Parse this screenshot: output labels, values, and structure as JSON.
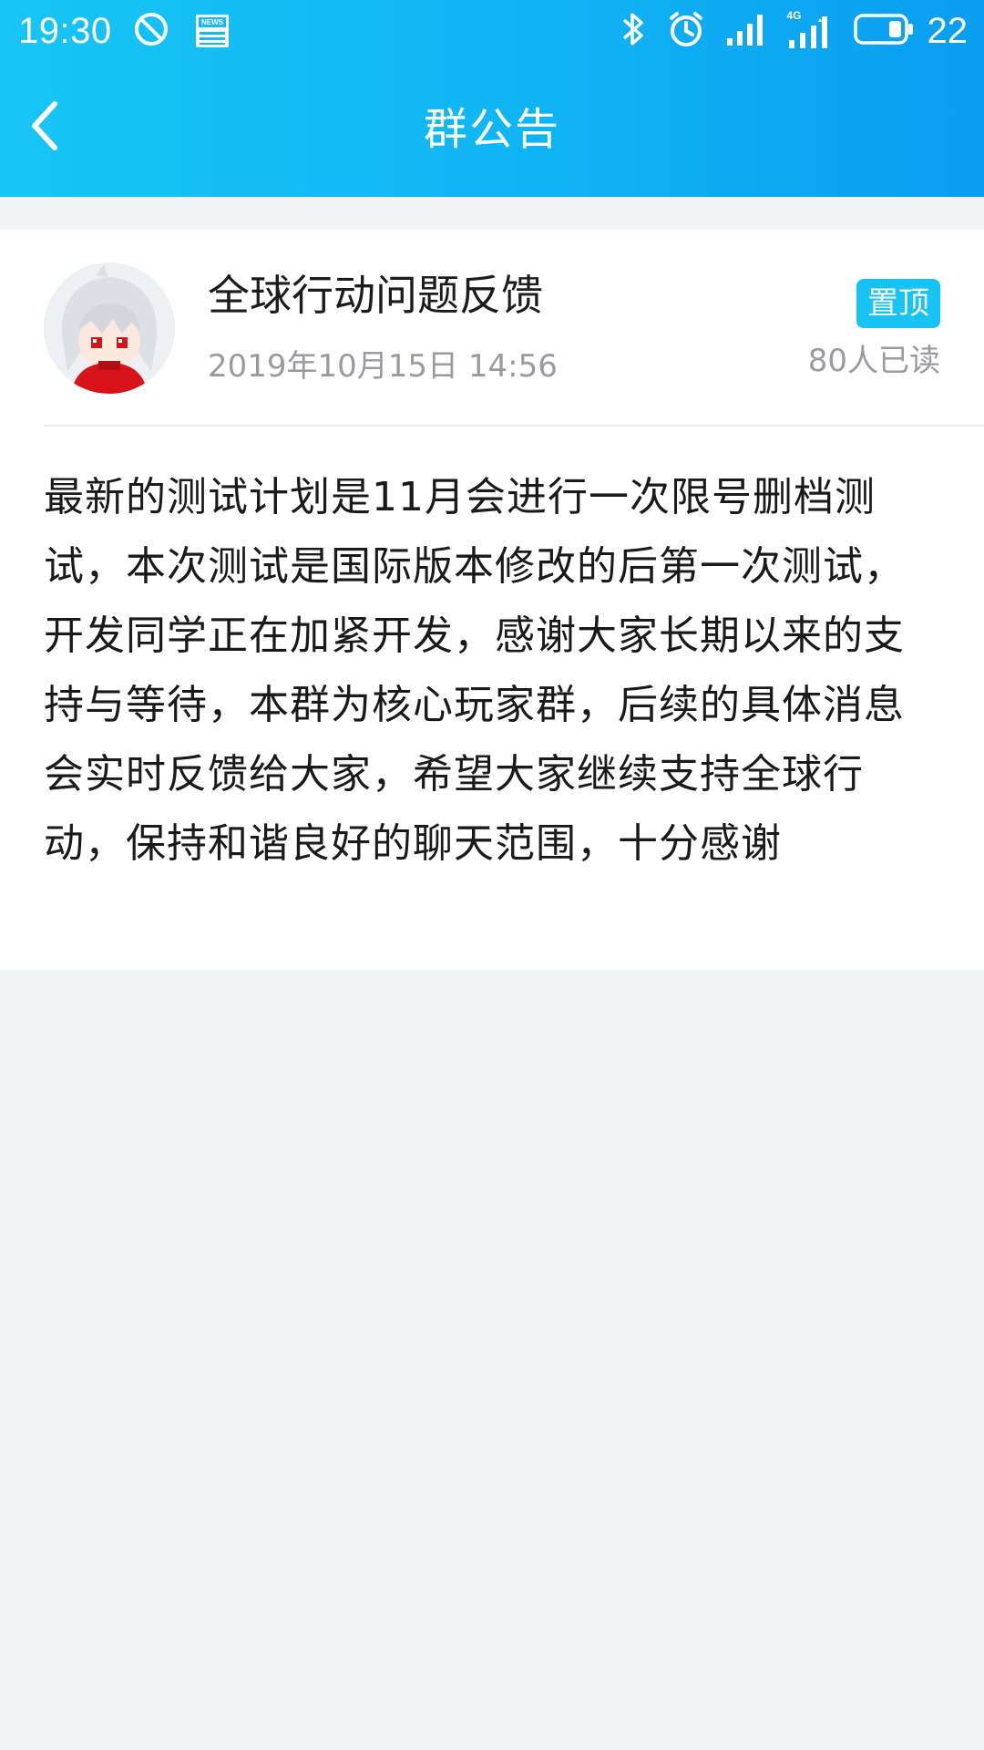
{
  "status_bar": {
    "time": "19:30",
    "left_icons": [
      "do-not-disturb-icon",
      "news-icon"
    ],
    "right_icons": [
      "bluetooth-icon",
      "alarm-icon",
      "signal-icon",
      "signal-4g-icon",
      "battery-icon"
    ],
    "battery_level": "22",
    "network_label": "4G",
    "news_label": "NEWS"
  },
  "title_bar": {
    "title": "群公告"
  },
  "announcement": {
    "author": "全球行动问题反馈",
    "timestamp": "2019年10月15日 14:56",
    "pin_label": "置顶",
    "read_count": "80人已读",
    "body": "最新的测试计划是11月会进行一次限号删档测试，本次测试是国际版本修改的后第一次测试，开发同学正在加紧开发，感谢大家长期以来的支持与等待，本群为核心玩家群，后续的具体消息会实时反馈给大家，希望大家继续支持全球行动，保持和谐良好的聊天范围，十分感谢"
  },
  "colors": {
    "header_start": "#17c5f5",
    "header_end": "#0a9df1",
    "badge": "#17c3f2",
    "background": "#f3f4f8"
  }
}
